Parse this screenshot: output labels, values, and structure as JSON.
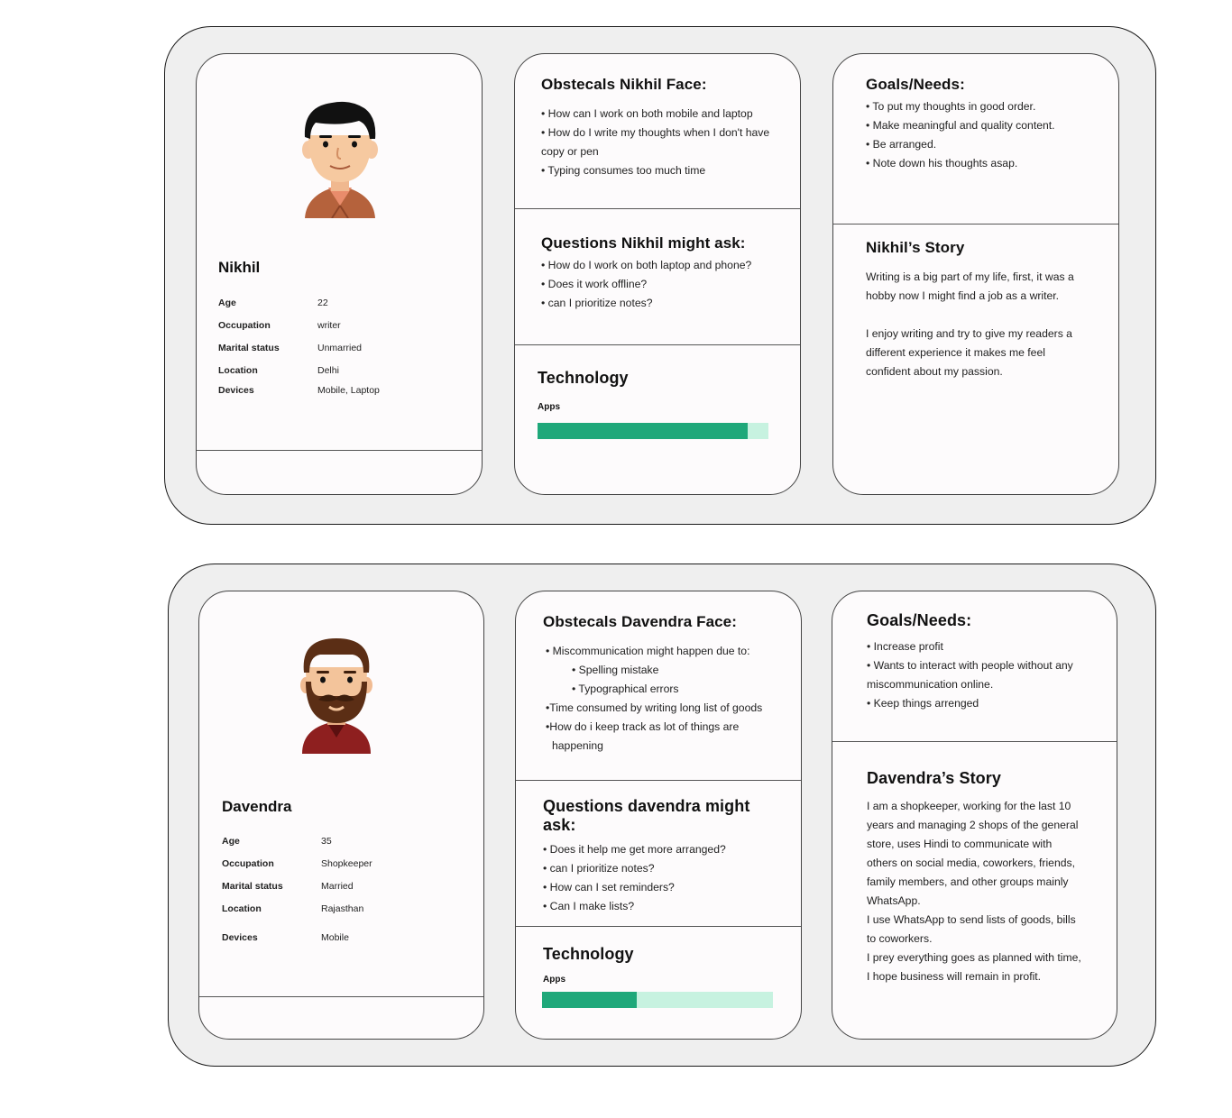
{
  "colors": {
    "bar_fill": "#1fa87a",
    "bar_track": "#c7f2e0"
  },
  "personas": [
    {
      "name": "Nikhil",
      "info": [
        {
          "label": "Age",
          "value": "22"
        },
        {
          "label": "Occupation",
          "value": "writer"
        },
        {
          "label": "Marital status",
          "value": "Unmarried"
        },
        {
          "label": "Location",
          "value": "Delhi"
        },
        {
          "label": "Devices",
          "value": "Mobile, Laptop"
        }
      ],
      "obstacles": {
        "title": "Obstecals Nikhil Face:",
        "items": [
          "• How can I work on both mobile and laptop",
          "• How do I write my thoughts when I don't have",
          "copy or pen",
          "• Typing consumes too much time"
        ]
      },
      "questions": {
        "title": "Questions Nikhil might ask:",
        "items": [
          "• How do I work on both laptop and phone?",
          "• Does it work offline?",
          "• can I prioritize notes?"
        ]
      },
      "technology": {
        "title": "Technology",
        "label": "Apps",
        "level": 0.91
      },
      "goals": {
        "title": "Goals/Needs:",
        "items": [
          "• To put my thoughts in good order.",
          "• Make meaningful and quality content.",
          "• Be arranged.",
          "• Note down his thoughts asap."
        ]
      },
      "story": {
        "title": "Nikhil’s Story",
        "paragraphs": [
          "Writing is a big part of my life, first, it was a hobby now I might find a job as a writer.",
          "I enjoy writing and try to give my readers a different experience it makes me feel confident about my passion."
        ]
      }
    },
    {
      "name": "Davendra",
      "info": [
        {
          "label": "Age",
          "value": "35"
        },
        {
          "label": "Occupation",
          "value": "Shopkeeper"
        },
        {
          "label": "Marital status",
          "value": "Married"
        },
        {
          "label": "Location",
          "value": "Rajasthan"
        },
        {
          "label": "Devices",
          "value": "Mobile"
        }
      ],
      "obstacles": {
        "title": "Obstecals Davendra Face:",
        "items": [
          "• Miscommunication might happen due to:",
          "• Spelling mistake",
          "• Typographical errors",
          "•Time consumed by writing long list of goods",
          "•How do i keep track as lot of things are",
          "  happening"
        ]
      },
      "questions": {
        "title": "Questions davendra might ask:",
        "items": [
          "• Does it help me get more arranged?",
          "• can I prioritize notes?",
          "• How can I set reminders?",
          "• Can I make lists?"
        ]
      },
      "technology": {
        "title": "Technology",
        "label": "Apps",
        "level": 0.41
      },
      "goals": {
        "title": "Goals/Needs:",
        "items": [
          "• Increase profit",
          "• Wants to interact with people without any",
          "miscommunication online.",
          "• Keep things arrenged"
        ]
      },
      "story": {
        "title": "Davendra’s Story",
        "paragraphs": [
          "I am a shopkeeper, working for the last 10 years and managing 2 shops of the general store, uses Hindi to communicate with others on social media, coworkers, friends, family members, and other groups mainly WhatsApp.",
          "I use WhatsApp to send lists of goods, bills to coworkers.",
          "I prey everything goes as planned with time, I hope business will remain in profit."
        ]
      }
    }
  ]
}
